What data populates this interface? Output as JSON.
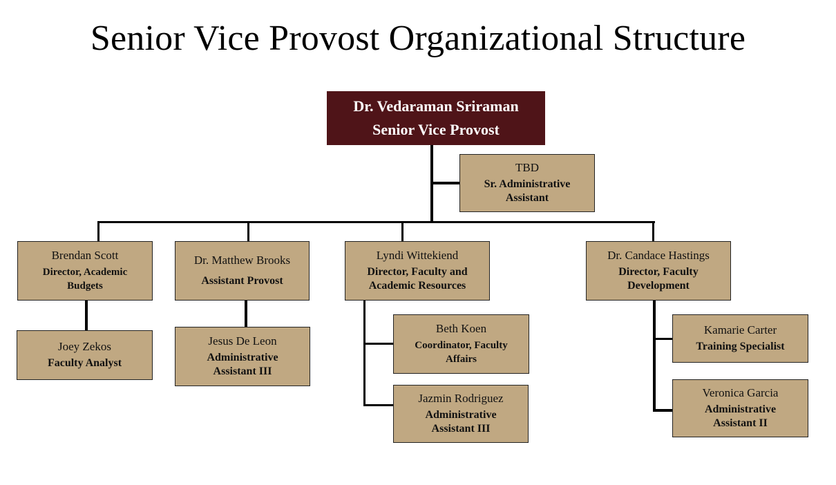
{
  "title": "Senior Vice Provost Organizational Structure",
  "colors": {
    "top_box": "#4f1418",
    "box": "#c0a882",
    "line": "#000000"
  },
  "top": {
    "name": "Dr. Vedaraman Sriraman",
    "role": "Senior Vice Provost"
  },
  "assistant": {
    "name": "TBD",
    "role": "Sr. Administrative Assistant"
  },
  "directors": [
    {
      "name": "Brendan Scott",
      "role": "Director, Academic Budgets",
      "reports": [
        {
          "name": "Joey Zekos",
          "role": "Faculty Analyst"
        }
      ]
    },
    {
      "name": "Dr. Matthew Brooks",
      "role": "Assistant Provost",
      "reports": [
        {
          "name": "Jesus De Leon",
          "role": "Administrative Assistant III"
        }
      ]
    },
    {
      "name": "Lyndi Wittekiend",
      "role": "Director, Faculty and Academic Resources",
      "reports": [
        {
          "name": "Beth Koen",
          "role": "Coordinator, Faculty Affairs"
        },
        {
          "name": "Jazmin Rodriguez",
          "role": "Administrative Assistant III"
        }
      ]
    },
    {
      "name": "Dr. Candace Hastings",
      "role": "Director, Faculty Development",
      "reports": [
        {
          "name": "Kamarie Carter",
          "role": "Training Specialist"
        },
        {
          "name": "Veronica Garcia",
          "role": "Administrative Assistant II"
        }
      ]
    }
  ]
}
